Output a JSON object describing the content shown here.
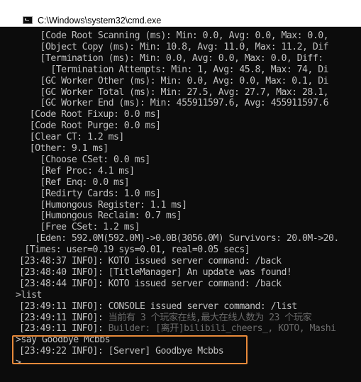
{
  "window": {
    "title": "C:\\Windows\\system32\\cmd.exe",
    "icon": "cmd-icon"
  },
  "console": {
    "lines": [
      "    [Code Root Scanning (ms): Min: 0.0, Avg: 0.0, Max: 0.0,",
      "    [Object Copy (ms): Min: 10.8, Avg: 11.0, Max: 11.2, Dif",
      "    [Termination (ms): Min: 0.0, Avg: 0.0, Max: 0.0, Diff: ",
      "      [Termination Attempts: Min: 1, Avg: 45.8, Max: 74, Di",
      "    [GC Worker Other (ms): Min: 0.0, Avg: 0.0, Max: 0.1, Di",
      "    [GC Worker Total (ms): Min: 27.5, Avg: 27.7, Max: 28.1,",
      "    [GC Worker End (ms): Min: 455911597.6, Avg: 455911597.6",
      "  [Code Root Fixup: 0.0 ms]",
      "  [Code Root Purge: 0.0 ms]",
      "  [Clear CT: 1.2 ms]",
      "  [Other: 9.1 ms]",
      "    [Choose CSet: 0.0 ms]",
      "    [Ref Proc: 4.1 ms]",
      "    [Ref Enq: 0.0 ms]",
      "    [Redirty Cards: 1.0 ms]",
      "    [Humongous Register: 1.1 ms]",
      "    [Humongous Reclaim: 0.7 ms]",
      "    [Free CSet: 1.2 ms]",
      "   [Eden: 592.0M(592.0M)->0.0B(3056.0M) Survivors: 20.0M->20.",
      " [Times: user=0.19 sys=0.01, real=0.05 secs]",
      "[23:48:37 INFO]: KOTO issued server command: /back",
      "[23:48:40 INFO]: [TitleManager] An update was found!",
      "[23:48:44 INFO]: KOTO issued server command: /back",
      ">list",
      "[23:49:11 INFO]: CONSOLE issued server command: /list",
      "[23:49:11 INFO]: 当前有 3 个玩家在线,最大在线人数为 23 个玩家",
      "[23:49:11 INFO]: Builder: [离开]bilibili_cheers_, KOTO, Mashi",
      ">say Goodbye Mcbbs",
      "[23:49:22 INFO]: [Server] Goodbye Mcbbs",
      ">"
    ],
    "dim_lines": [
      25,
      26
    ]
  },
  "highlight": {
    "color": "#e88a3a",
    "label": "highlight-box"
  },
  "colors": {
    "text": "#c0c0c0",
    "background": "#0c0c0c",
    "dim_text": "#6a6a6a",
    "highlight_border": "#e88a3a"
  }
}
